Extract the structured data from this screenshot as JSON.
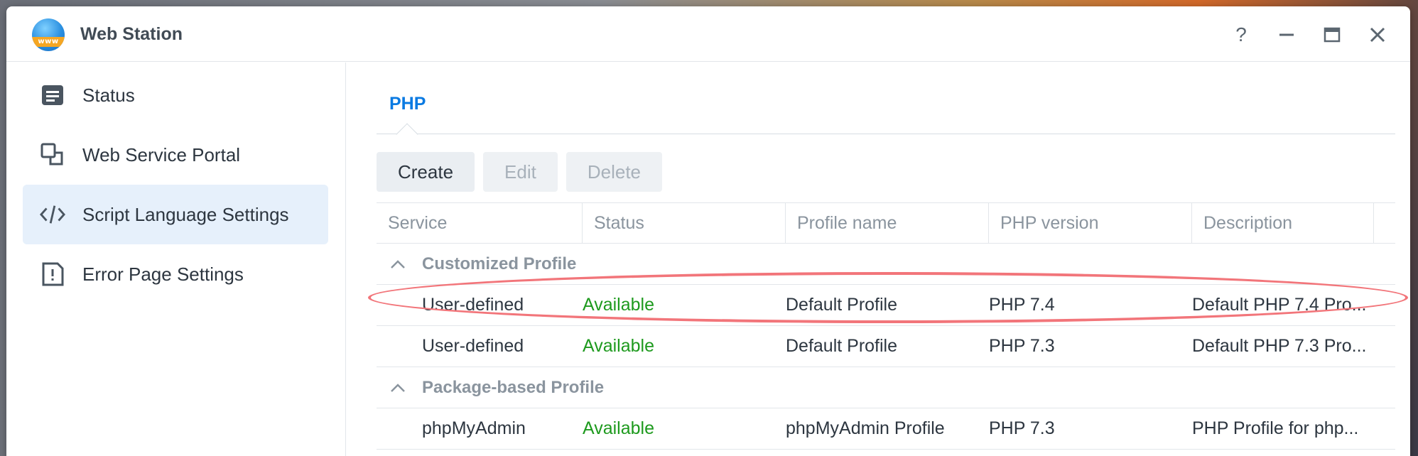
{
  "window": {
    "title": "Web Station",
    "app_icon_text": "www",
    "controls": {
      "help": "?",
      "minimize": "—",
      "maximize": "▭",
      "close": "✕"
    }
  },
  "sidebar": {
    "items": [
      {
        "label": "Status",
        "icon": "status-icon",
        "active": false
      },
      {
        "label": "Web Service Portal",
        "icon": "portal-icon",
        "active": false
      },
      {
        "label": "Script Language Settings",
        "icon": "code-icon",
        "active": true
      },
      {
        "label": "Error Page Settings",
        "icon": "error-page-icon",
        "active": false
      }
    ]
  },
  "tabs": [
    {
      "label": "PHP",
      "active": true
    }
  ],
  "toolbar": {
    "create": "Create",
    "edit": "Edit",
    "delete": "Delete"
  },
  "table": {
    "columns": [
      "Service",
      "Status",
      "Profile name",
      "PHP version",
      "Description"
    ],
    "groups": [
      {
        "label": "Customized Profile",
        "rows": [
          {
            "service": "User-defined",
            "status": "Available",
            "profile": "Default Profile",
            "version": "PHP 7.4",
            "description": "Default PHP 7.4 Pro..."
          },
          {
            "service": "User-defined",
            "status": "Available",
            "profile": "Default Profile",
            "version": "PHP 7.3",
            "description": "Default PHP 7.3 Pro..."
          }
        ]
      },
      {
        "label": "Package-based Profile",
        "rows": [
          {
            "service": "phpMyAdmin",
            "status": "Available",
            "profile": "phpMyAdmin Profile",
            "version": "PHP 7.3",
            "description": "PHP Profile for php..."
          }
        ]
      }
    ]
  },
  "colors": {
    "accent": "#0a7ae2",
    "available": "#1e9a1e",
    "highlight": "#f2757a",
    "active_nav": "#e6f0fb"
  }
}
